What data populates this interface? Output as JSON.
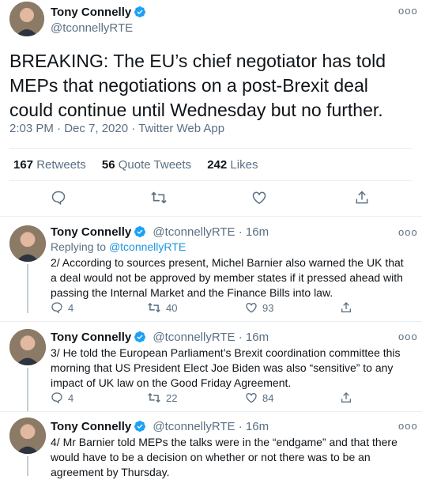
{
  "main_tweet": {
    "name": "Tony Connelly",
    "handle": "@tconnellyRTE",
    "text": "BREAKING: The EU’s chief negotiator has told MEPs that negotiations on a post-Brexit deal could continue until Wednesday but no further.",
    "time": "2:03 PM · Dec 7, 2020 · Twitter Web App",
    "retweets_count": "167",
    "retweets_label": "Retweets",
    "quote_count": "56",
    "quote_label": "Quote Tweets",
    "likes_count": "242",
    "likes_label": "Likes"
  },
  "replies": [
    {
      "name": "Tony Connelly",
      "handle": "@tconnellyRTE",
      "time": "· 16m",
      "replying_prefix": "Replying to",
      "replying_handle": "@tconnellyRTE",
      "text": "2/ According to sources present, Michel Barnier also warned the UK that a deal would not be approved by member states if it pressed ahead with passing the Internal Market and the Finance Bills into law.",
      "replies": "4",
      "retweets": "40",
      "likes": "93"
    },
    {
      "name": "Tony Connelly",
      "handle": "@tconnellyRTE",
      "time": "· 16m",
      "text": "3/ He told the European Parliament’s Brexit coordination committee this morning that US President Elect Joe Biden was also “sensitive” to any impact of UK law on the Good Friday Agreement.",
      "replies": "4",
      "retweets": "22",
      "likes": "84"
    },
    {
      "name": "Tony Connelly",
      "handle": "@tconnellyRTE",
      "time": "· 16m",
      "text": "4/ Mr Barnier told MEPs the talks were in the “endgame” and that there would have to be a decision on whether or not there was to be an agreement by Thursday."
    }
  ],
  "icons": [
    "avatar",
    "verified-badge-icon",
    "more-icon",
    "reply-icon",
    "retweet-icon",
    "like-icon",
    "share-icon"
  ],
  "colors": {
    "text": "#0f1419",
    "muted": "#5b7083",
    "accent": "#1b95e0",
    "divider": "#ebeef0"
  }
}
